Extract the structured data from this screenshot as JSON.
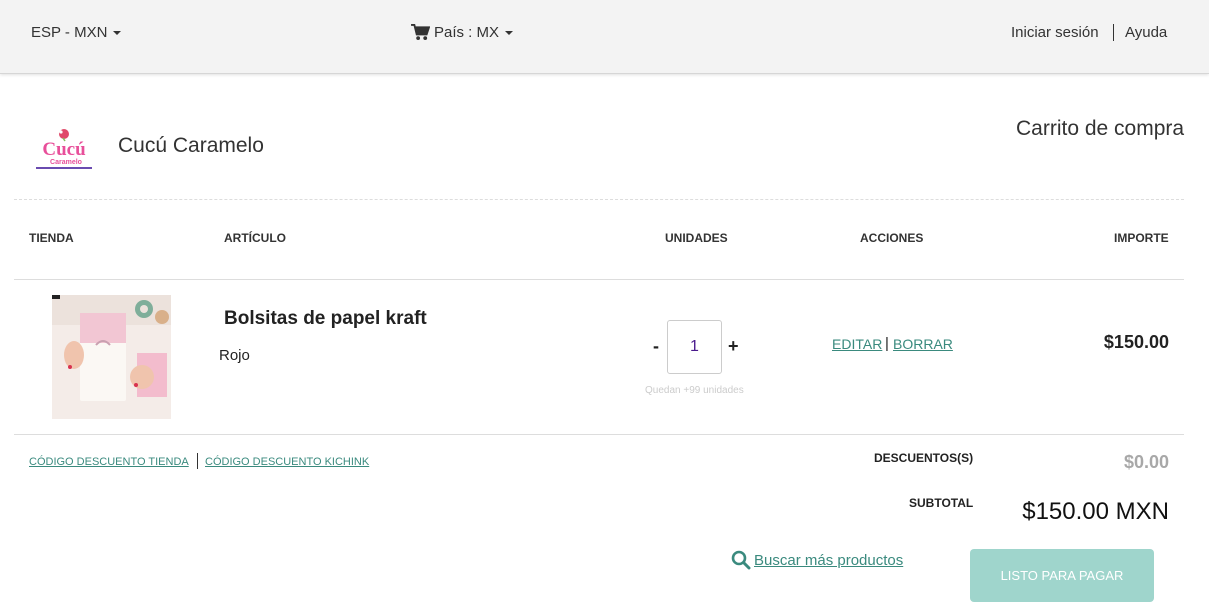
{
  "topbar": {
    "language_currency": "ESP - MXN",
    "country": "País : MX",
    "login": "Iniciar sesión",
    "help": "Ayuda"
  },
  "store": {
    "logo_text": "Cucú",
    "logo_subtext": "Caramelo",
    "name": "Cucú Caramelo",
    "page_title": "Carrito de compra"
  },
  "table": {
    "headers": [
      "TIENDA",
      "ARTÍCULO",
      "UNIDADES",
      "ACCIONES",
      "IMPORTE"
    ]
  },
  "cart_items": [
    {
      "name": "Bolsitas de papel kraft",
      "variant": "Rojo",
      "quantity": "1",
      "minus_label": "-",
      "plus_label": "+",
      "stock_note": "Quedan +99 unidades",
      "edit_label": "EDITAR",
      "separator": "|",
      "delete_label": "BORRAR",
      "price": "$150.00"
    }
  ],
  "summary": {
    "store_discount_link": "CÓDIGO DESCUENTO TIENDA",
    "kichink_discount_link": "CÓDIGO DESCUENTO KICHINK",
    "discount_label": "DESCUENTOS(S)",
    "discount_value": "$0.00",
    "subtotal_label": "SUBTOTAL",
    "subtotal_value": "$150.00 MXN",
    "search_more": " Buscar más productos",
    "checkout_button": "LISTO PARA PAGAR"
  },
  "colors": {
    "accent": "#3a8a7e",
    "button_bg": "#9fd5cc",
    "topbar_bg": "#f3f3f3",
    "quantity_text": "#4a1a8c"
  }
}
